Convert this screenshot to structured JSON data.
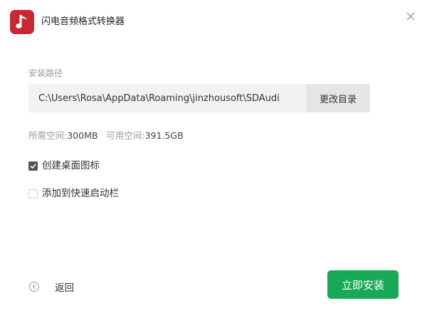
{
  "app": {
    "title": "闪电音频格式转换器",
    "logo_icon": "music-note-icon",
    "brand_color": "#c8282f"
  },
  "window": {
    "close_icon": "close-icon"
  },
  "install_path": {
    "label": "安装路径",
    "value": "C:\\Users\\Rosa\\AppData\\Roaming\\jinzhousoft\\SDAudi",
    "change_button_label": "更改目录"
  },
  "space": {
    "required_label": "所需空间:",
    "required_value": "300MB",
    "available_label": "可用空间:",
    "available_value": "391.5GB"
  },
  "options": [
    {
      "label": "创建桌面图标",
      "checked": true
    },
    {
      "label": "添加到快速启动栏",
      "checked": false
    }
  ],
  "footer": {
    "back_label": "返回",
    "back_icon": "circle-arrow-left-icon",
    "install_label": "立即安装",
    "install_color": "#18a957"
  }
}
